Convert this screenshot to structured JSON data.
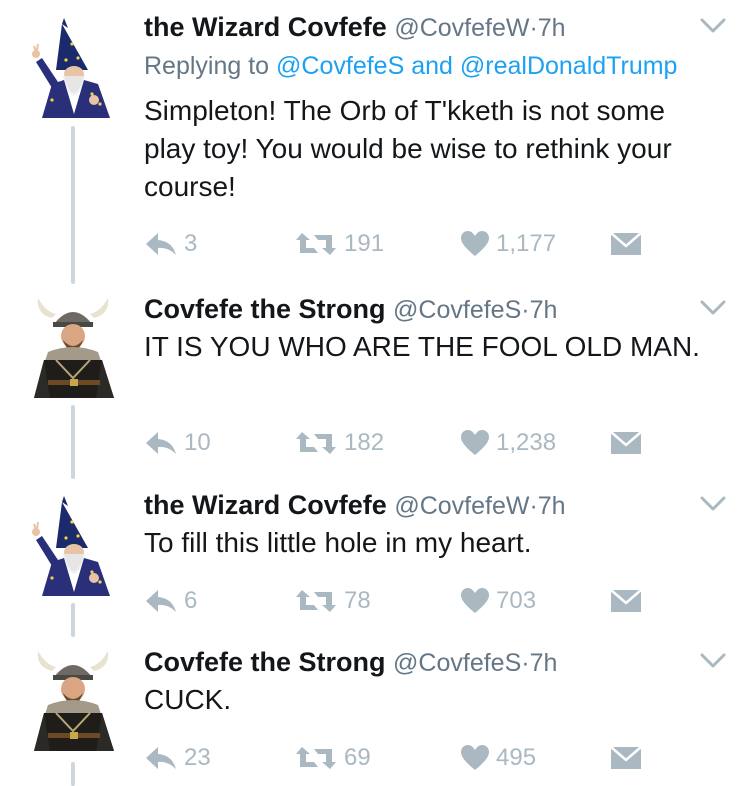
{
  "tweets": [
    {
      "name": "the Wizard Covfefe",
      "handle": "@CovfefeW",
      "time": "7h",
      "replying_prefix": "Replying to",
      "replying_to_1": "@CovfefeS",
      "replying_and": "and",
      "replying_to_2": "@realDonaldTrump",
      "text": "Simpleton! The Orb of T'kketh is not some play toy! You would be wise to rethink your course!",
      "replies": "3",
      "retweets": "191",
      "likes": "1,177"
    },
    {
      "name": "Covfefe the Strong",
      "handle": "@CovfefeS",
      "time": "7h",
      "text": "IT IS YOU WHO ARE THE FOOL OLD MAN.",
      "replies": "10",
      "retweets": "182",
      "likes": "1,238"
    },
    {
      "name": "the Wizard Covfefe",
      "handle": "@CovfefeW",
      "time": "7h",
      "text": "To fill this little hole in my heart.",
      "replies": "6",
      "retweets": "78",
      "likes": "703"
    },
    {
      "name": "Covfefe the Strong",
      "handle": "@CovfefeS",
      "time": "7h",
      "text": "CUCK.",
      "replies": "23",
      "retweets": "69",
      "likes": "495"
    }
  ],
  "separator": "·",
  "icons": {
    "reply": "reply-icon",
    "retweet": "retweet-icon",
    "like": "heart-icon",
    "dm": "envelope-icon",
    "more": "chevron-down-icon"
  },
  "colors": {
    "text": "#14171a",
    "muted": "#657786",
    "link": "#1da1f2",
    "icon": "#aab8c2",
    "thread_line": "#ccd6dd"
  }
}
